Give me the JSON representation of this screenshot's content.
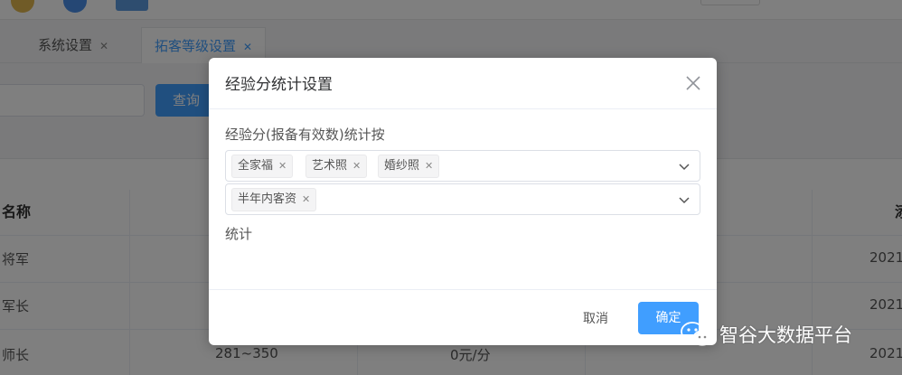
{
  "tabs": [
    {
      "label": "系统设置"
    },
    {
      "label": "拓客等级设置"
    }
  ],
  "search": {
    "button_label": "查询"
  },
  "table": {
    "header_left": "名称",
    "header_right": "添",
    "rows": [
      {
        "name": "将军",
        "range": "",
        "price": "",
        "date": "2021"
      },
      {
        "name": "军长",
        "range": "",
        "price": "",
        "date": "2021"
      },
      {
        "name": "师长",
        "range": "281~350",
        "price": "0元/分",
        "date": "2021"
      }
    ]
  },
  "dialog": {
    "title": "经验分统计设置",
    "field_label": "经验分(报备有效数)统计按",
    "select1_tags": [
      "全家福",
      "艺术照",
      "婚纱照"
    ],
    "select2_tags": [
      "半年内客资"
    ],
    "stat_text": "统计",
    "cancel_label": "取消",
    "ok_label": "确定"
  },
  "watermark": {
    "text": "智谷大数据平台"
  },
  "colors": {
    "primary": "#409eff",
    "overlay": "rgba(0,0,0,0.5)"
  }
}
